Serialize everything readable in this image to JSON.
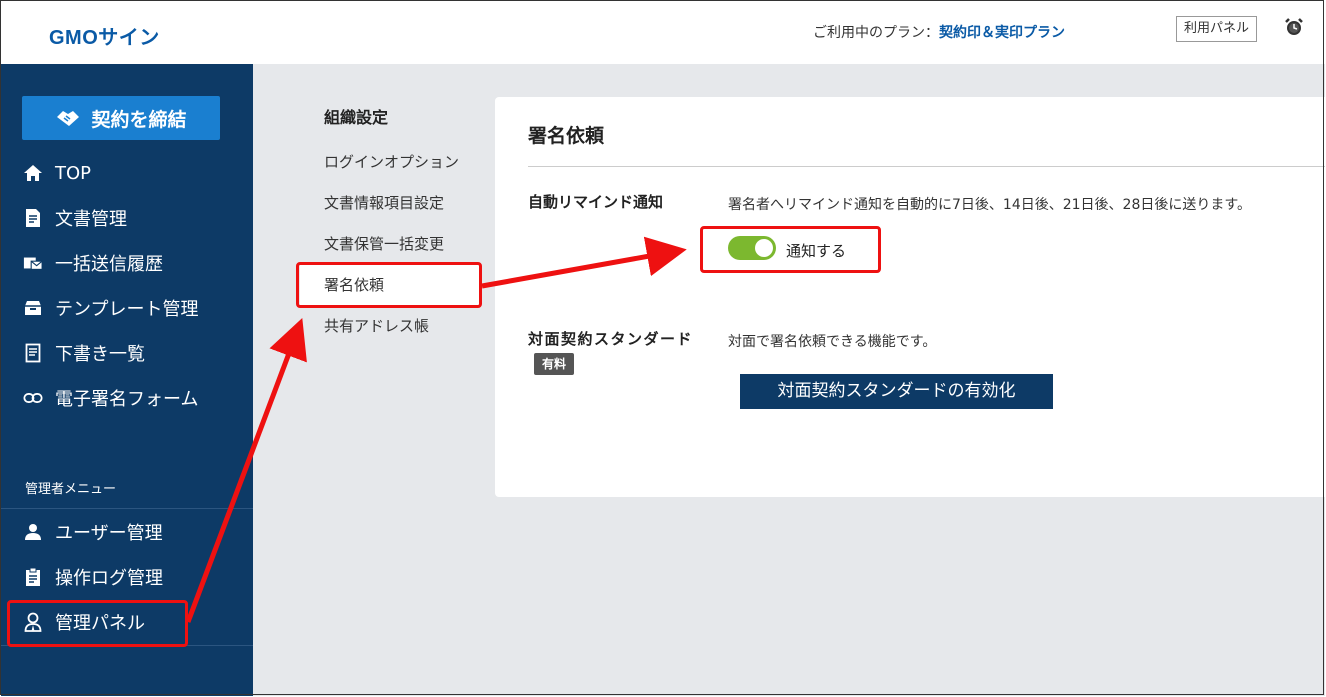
{
  "header": {
    "logo": "GMOサイン",
    "plan_prefix": "ご利用中のプラン：",
    "plan_name": "契約印＆実印プラン",
    "panel_button": "利用パネル",
    "alarm_icon": "alarm-clock-icon"
  },
  "sidebar": {
    "cta_label": "契約を締結",
    "cta_icon": "handshake-icon",
    "items": [
      {
        "label": "TOP",
        "icon": "home-icon"
      },
      {
        "label": "文書管理",
        "icon": "document-icon"
      },
      {
        "label": "一括送信履歴",
        "icon": "bulk-send-icon"
      },
      {
        "label": "テンプレート管理",
        "icon": "template-icon"
      },
      {
        "label": "下書き一覧",
        "icon": "draft-icon"
      },
      {
        "label": "電子署名フォーム",
        "icon": "link-icon"
      }
    ],
    "admin_label": "管理者メニュー",
    "admin_items": [
      {
        "label": "ユーザー管理",
        "icon": "user-icon"
      },
      {
        "label": "操作ログ管理",
        "icon": "log-icon"
      },
      {
        "label": "管理パネル",
        "icon": "admin-user-icon"
      }
    ]
  },
  "subnav": {
    "title": "組織設定",
    "items": [
      "ログインオプション",
      "文書情報項目設定",
      "文書保管一括変更",
      "署名依頼",
      "共有アドレス帳"
    ]
  },
  "card": {
    "title": "署名依頼",
    "remind_label": "自動リマインド通知",
    "remind_desc": "署名者へリマインド通知を自動的に7日後、14日後、21日後、28日後に送ります。",
    "toggle_label": "通知する",
    "toggle_on": true,
    "face_label": "対面契約スタンダード",
    "badge": "有料",
    "face_desc": "対面で署名依頼できる機能です。",
    "face_button": "対面契約スタンダードの有効化"
  },
  "colors": {
    "sidebar": "#0d3a66",
    "cta": "#1a7fd0",
    "toggle_on": "#7cb82f",
    "highlight": "#ee1111",
    "brand": "#0a5aa6"
  }
}
